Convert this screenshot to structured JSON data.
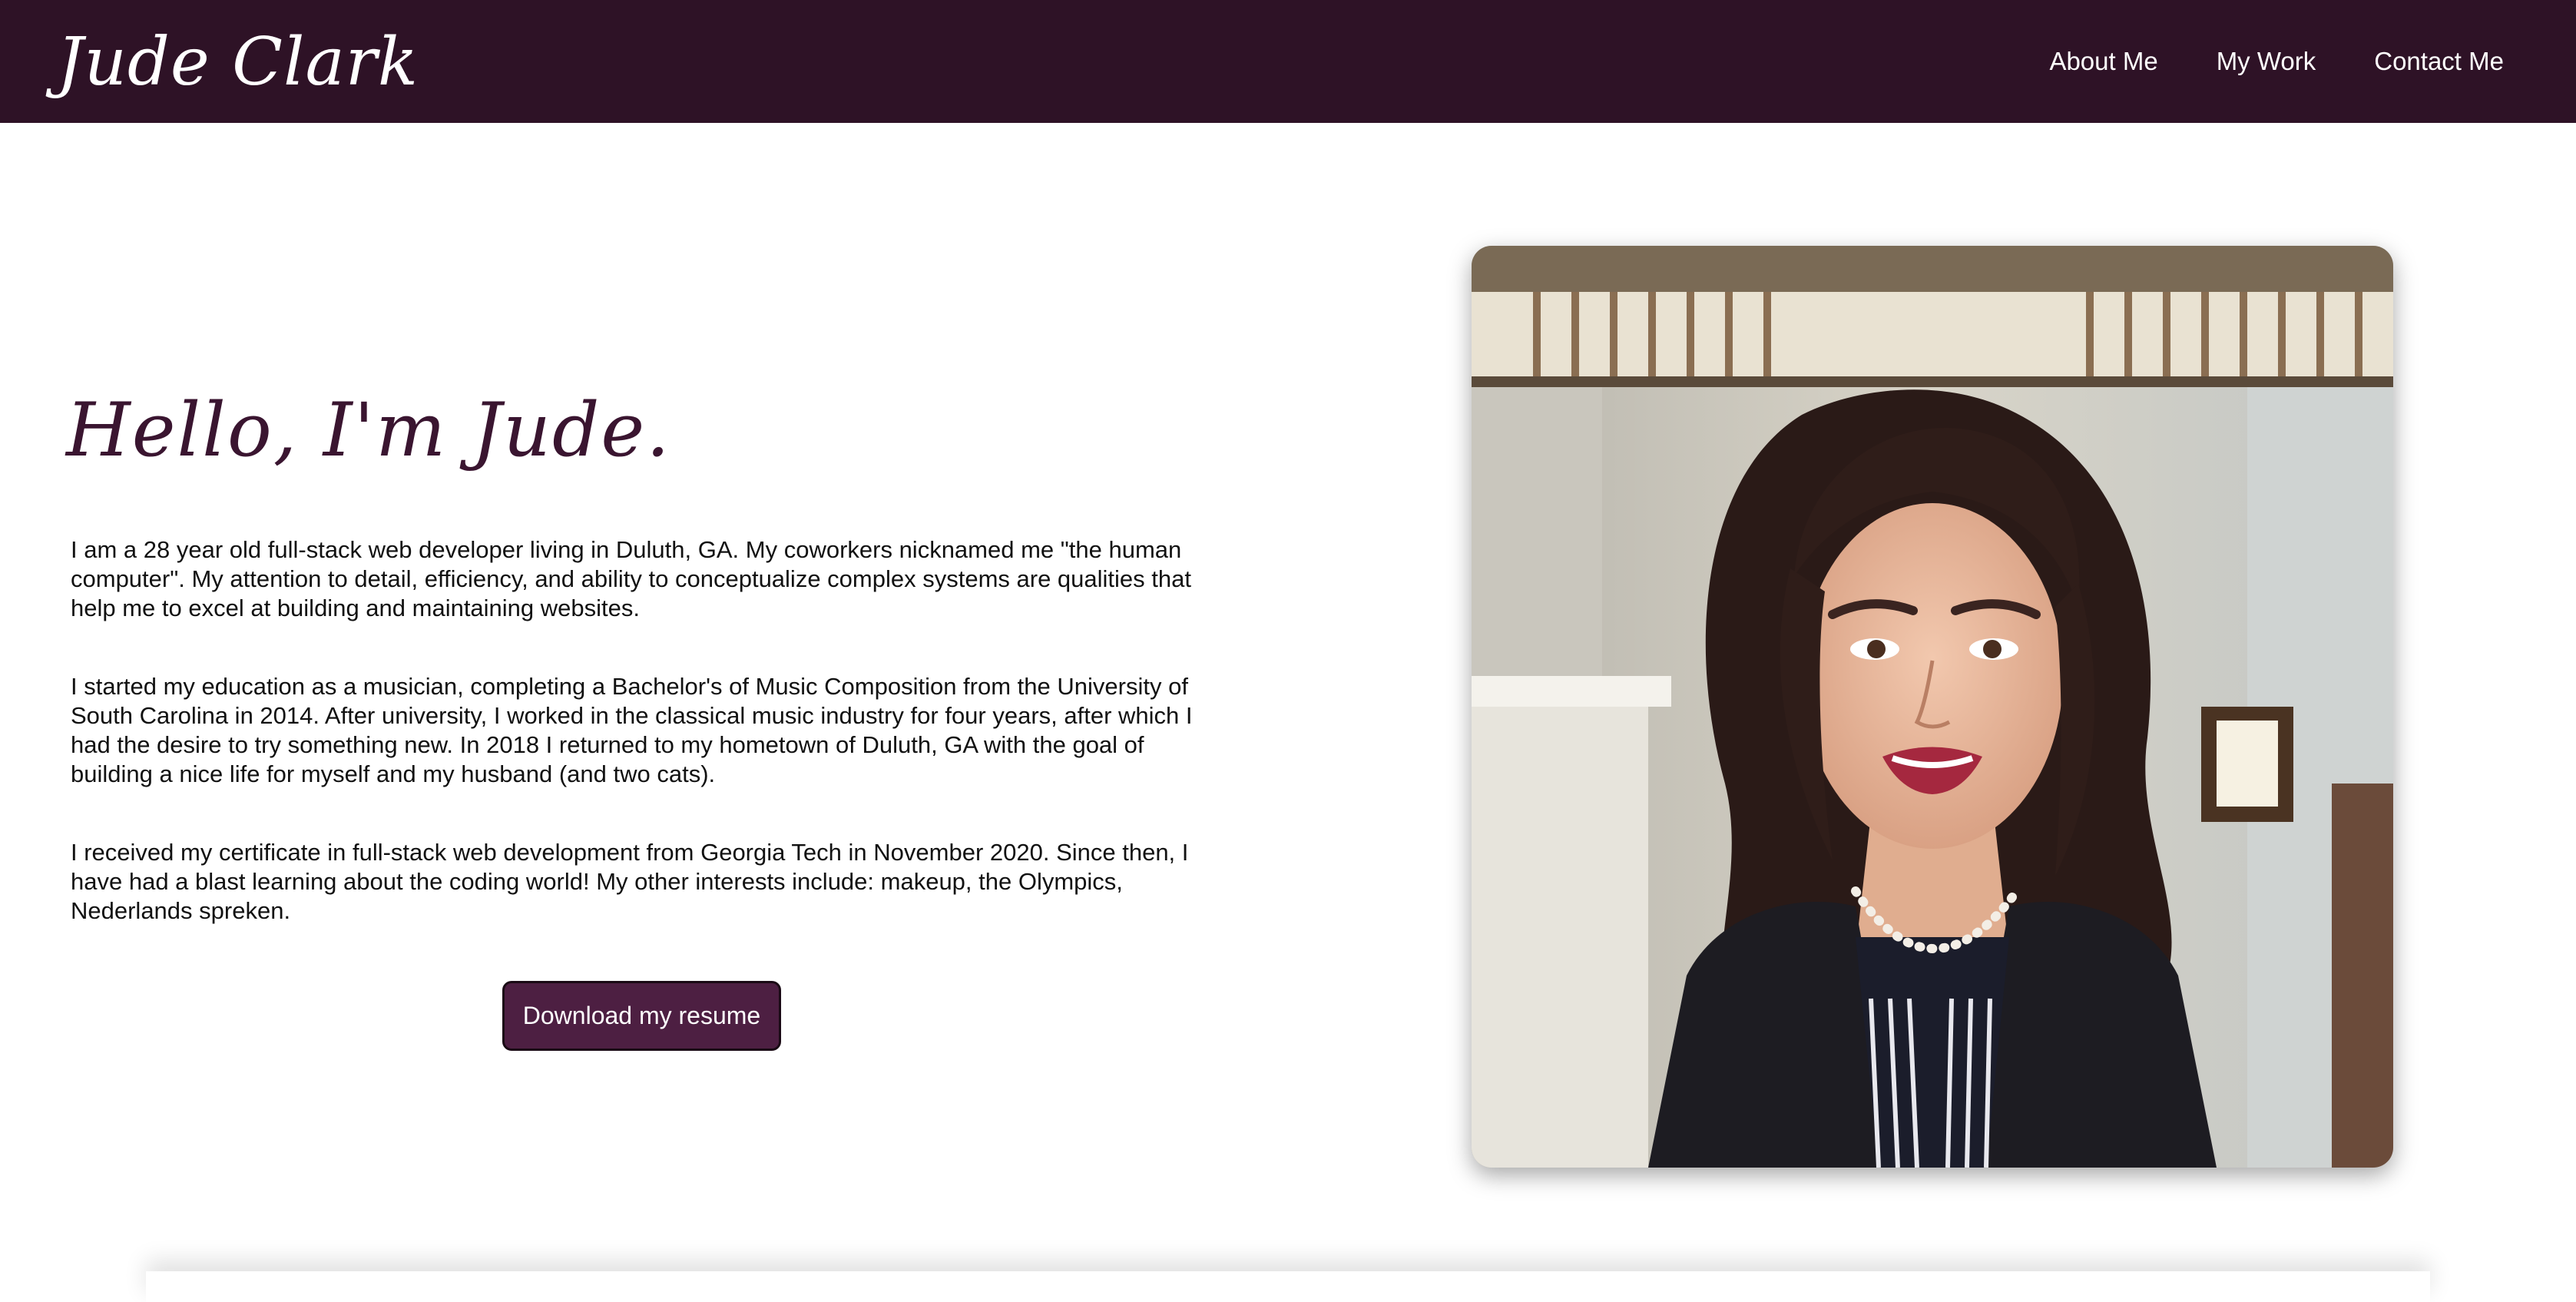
{
  "header": {
    "brand": "Jude Clark",
    "nav": [
      {
        "label": "About Me"
      },
      {
        "label": "My Work"
      },
      {
        "label": "Contact Me"
      }
    ],
    "background_color": "#2e1226"
  },
  "intro": {
    "greeting": "Hello, I'm Jude.",
    "paragraphs": [
      "I am a 28 year old full-stack web developer living in Duluth, GA. My coworkers nicknamed me \"the human computer\". My attention to detail, efficiency, and ability to conceptualize complex systems are qualities that help me to excel at building and maintaining websites.",
      "I started my education as a musician, completing a Bachelor's of Music Composition from the University of South Carolina in 2014. After university, I worked in the classical music industry for four years, after which I had the desire to try something new. In 2018 I returned to my hometown of Duluth, GA with the goal of building a nice life for myself and my husband (and two cats).",
      "I received my certificate in full-stack web development from Georgia Tech in November 2020. Since then, I have had a blast learning about the coding world! My other interests include: makeup, the Olympics, Nederlands spreken."
    ],
    "resume_button": "Download my resume",
    "accent_color": "#4d1f42"
  },
  "portrait": {
    "icon": "profile-photo"
  }
}
